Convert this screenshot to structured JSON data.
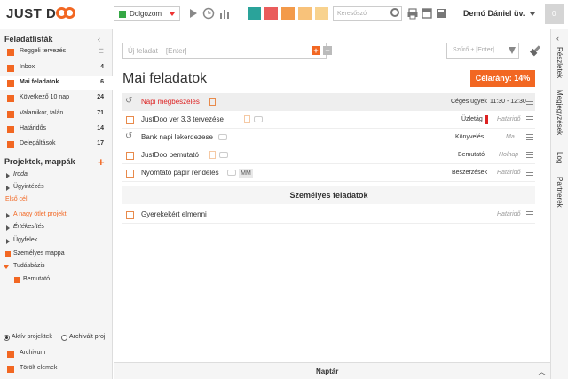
{
  "app": {
    "logo_left": "JUST D",
    "logo_right": "",
    "brand_color": "#f26722"
  },
  "topbar": {
    "status_label": "Dolgozom",
    "status_color": "#35a845",
    "swatches": [
      "#2aa39a",
      "#ea5c5c",
      "#f39a4a",
      "#f8c27a",
      "#f8d28e"
    ],
    "search_placeholder": "Keresőszó",
    "user_name": "Demó Dániel üv.",
    "avatar_text": "0"
  },
  "sidebar": {
    "lists_title": "Feladatlisták",
    "collapse_icon": "chevron-left-icon",
    "lists": [
      {
        "label": "Reggeli tervezés",
        "count": "",
        "active": false
      },
      {
        "label": "Inbox",
        "count": "4",
        "active": false
      },
      {
        "label": "Mai feladatok",
        "count": "6",
        "active": true
      },
      {
        "label": "Következő 10 nap",
        "count": "24",
        "active": false
      },
      {
        "label": "Valamikor, talán",
        "count": "71",
        "active": false
      },
      {
        "label": "Határidős",
        "count": "14",
        "active": false
      },
      {
        "label": "Delegáltások",
        "count": "17",
        "active": false
      }
    ],
    "projects_title": "Projektek, mappák",
    "projects": [
      {
        "label": "Iroda",
        "style": "italic",
        "color": "#333"
      },
      {
        "label": "Ügyintézés",
        "style": "normal",
        "color": "#333"
      },
      {
        "label": "Első cél",
        "style": "normal",
        "color": "#f26722"
      },
      {
        "label": "A nagy ötlet projekt",
        "style": "normal",
        "color": "#f26722"
      },
      {
        "label": "Értékesítés",
        "style": "italic",
        "color": "#333"
      },
      {
        "label": "Ügyfelek",
        "style": "normal",
        "color": "#333"
      },
      {
        "label": "Személyes mappa",
        "style": "normal",
        "color": "#333"
      },
      {
        "label": "Tudásbázis",
        "style": "normal",
        "color": "#333"
      },
      {
        "label": "Bemutató",
        "style": "normal",
        "color": "#333"
      }
    ],
    "radio_active": "Aktív projektek",
    "radio_archived": "Archivált proj.",
    "archive_label": "Archivum",
    "deleted_label": "Törölt elemek"
  },
  "main": {
    "new_task_placeholder": "Új feladat + [Enter]",
    "filter_placeholder": "Szűrő + [Enter]",
    "page_title": "Mai feladatok",
    "goal_button": "Célarány: 14%",
    "tasks": [
      {
        "name": "Napi megbeszelés",
        "category": "Céges ügyek",
        "due": "",
        "time": "11:30 - 12:30"
      },
      {
        "name": "JustDoo ver 3.3 tervezése",
        "category": "Üzletág 1",
        "due": "Határidő",
        "time": ""
      },
      {
        "name": "Bank napi lekerdezese",
        "category": "Könyvelés",
        "due": "Ma",
        "time": ""
      },
      {
        "name": "JustDoo bemutató",
        "category": "Bemutató",
        "due": "Holnap",
        "time": ""
      },
      {
        "name": "Nyomtató papír rendelés",
        "category": "Beszerzések",
        "due": "Határidő",
        "time": ""
      },
      {
        "name": "Gyerekekért elmenni",
        "category": "",
        "due": "Határidő",
        "time": ""
      }
    ],
    "task_tag": "MM",
    "section_personal": "Személyes feladatok"
  },
  "rightbar": {
    "tabs": [
      "Részletek",
      "Megjegyzések",
      "Log",
      "Partnerek"
    ]
  },
  "calendar": {
    "label": "Naptár"
  }
}
